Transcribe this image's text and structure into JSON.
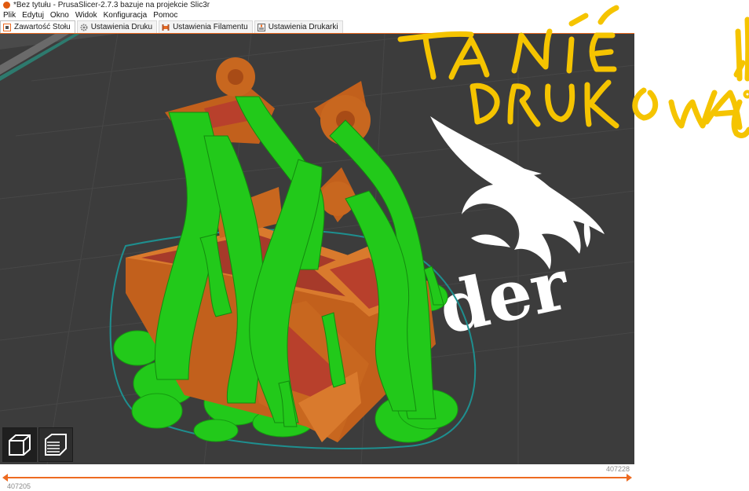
{
  "window": {
    "title": "*Bez tytułu - PrusaSlicer-2.7.3 bazuje na projekcie Slic3r"
  },
  "menu": [
    "Plik",
    "Edytuj",
    "Okno",
    "Widok",
    "Konfiguracja",
    "Pomoc"
  ],
  "tabs": [
    {
      "label": "Zawartość Stołu",
      "icon": "plater-icon",
      "active": true
    },
    {
      "label": "Ustawienia Druku",
      "icon": "gear-icon",
      "active": false
    },
    {
      "label": "Ustawienia Filamentu",
      "icon": "spool-icon",
      "active": false
    },
    {
      "label": "Ustawienia Drukarki",
      "icon": "printer-icon",
      "active": false
    }
  ],
  "viewport": {
    "bed_logo_text": "der",
    "colors": {
      "background": "#4a4a4a",
      "bed": "#3a3a3a",
      "part": "#d2691e",
      "support": "#22c91a",
      "infill": "#c0392b",
      "skirt": "#1e8f8f"
    }
  },
  "view_buttons": [
    {
      "name": "3d-view-icon",
      "active": true
    },
    {
      "name": "layers-view-icon",
      "active": false
    }
  ],
  "slider": {
    "top_value": "407228",
    "bottom_value": "407205",
    "color": "#ed6b21"
  },
  "annotation": {
    "text": "TA NIE DRUKOWAĆ!",
    "color": "#f5c400"
  }
}
